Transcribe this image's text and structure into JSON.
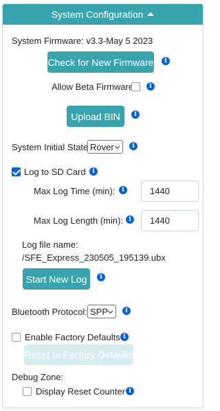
{
  "header": {
    "title": "System Configuration"
  },
  "firmware": {
    "label": "System Firmware: v3.3-May 5 2023",
    "check_button": "Check for New Firmware",
    "allow_beta_label": "Allow Beta Firmware",
    "allow_beta_checked": false,
    "upload_button": "Upload BIN"
  },
  "initial_state": {
    "label": "System Initial State:",
    "value": "Rover"
  },
  "logging": {
    "log_to_sd_label": "Log to SD Card",
    "log_to_sd_checked": true,
    "max_log_time_label": "Max Log Time (min):",
    "max_log_time_value": "1440",
    "max_log_length_label": "Max Log Length (min):",
    "max_log_length_value": "1440",
    "file_name_label": "Log file name:",
    "file_name_value": "/SFE_Express_230505_195139.ubx",
    "start_new_log_button": "Start New Log"
  },
  "bluetooth": {
    "label": "Bluetooth Protocol:",
    "value": "SPP"
  },
  "factory": {
    "enable_label": "Enable Factory Defaults",
    "enable_checked": false,
    "reset_button": "Reset to Factory Defaults"
  },
  "debug": {
    "zone_label": "Debug Zone:",
    "display_reset_label": "Display Reset Counter",
    "display_reset_checked": false
  },
  "info_glyph": "i",
  "colors": {
    "header": "#3aa4ae",
    "button": "#3aa4ae",
    "info_icon": "#0b62d6",
    "checkbox_checked": "#0b62d6"
  }
}
